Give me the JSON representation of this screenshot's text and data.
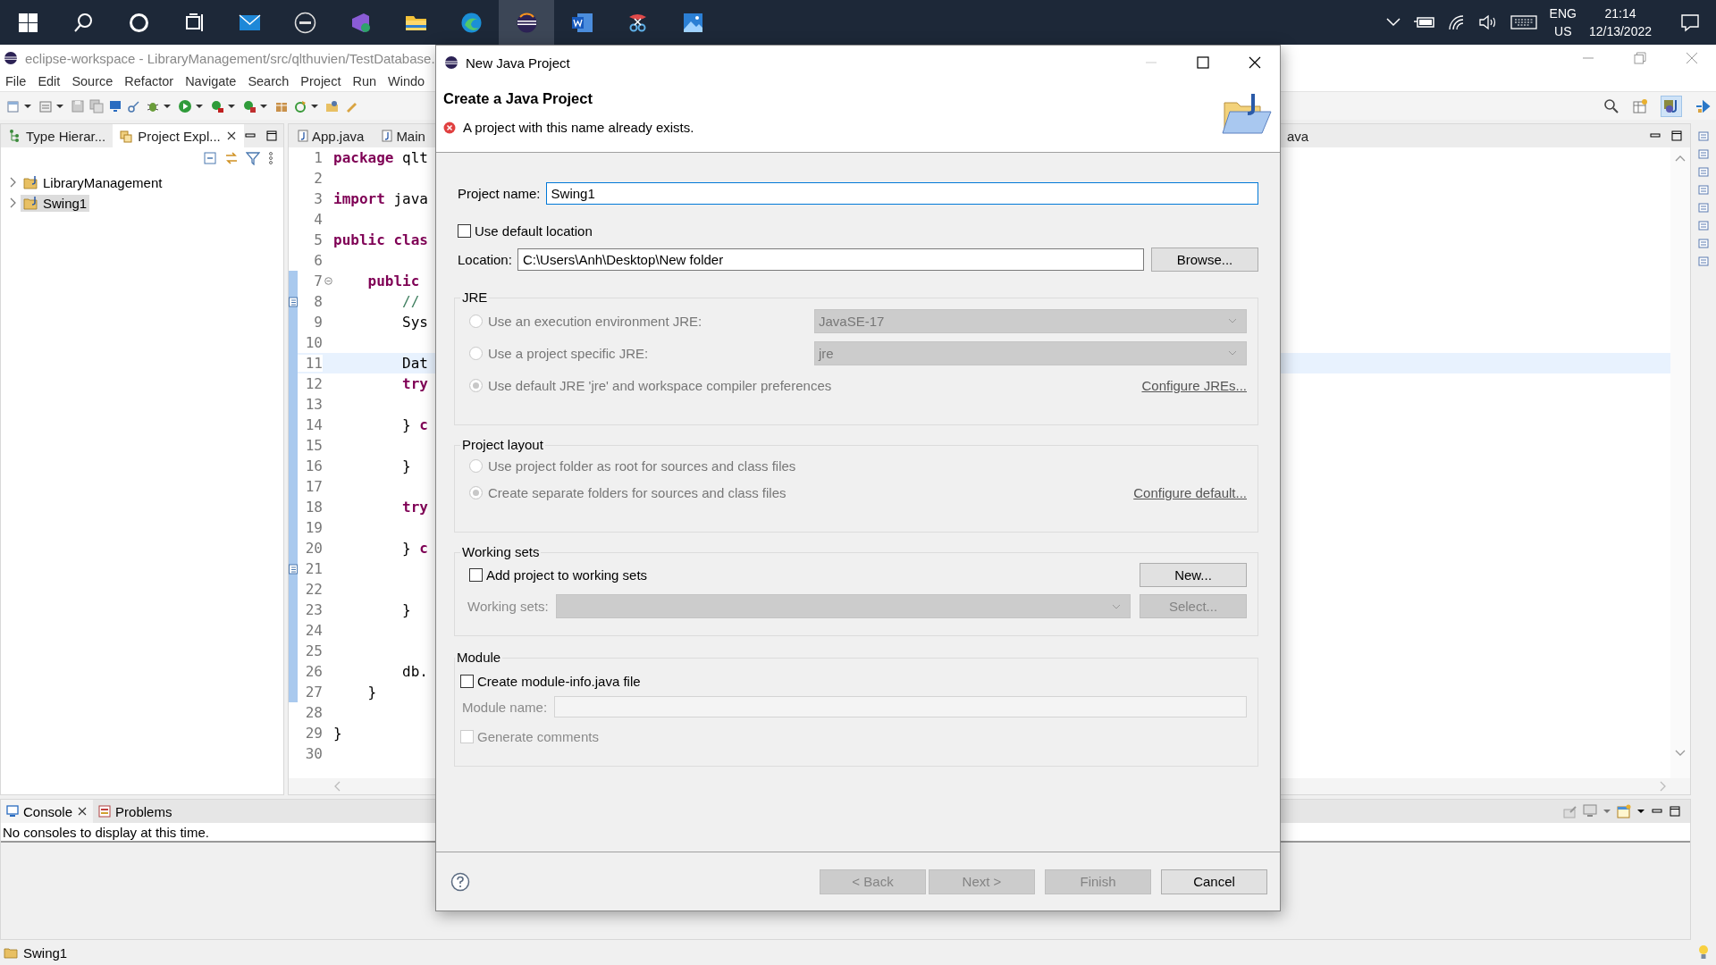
{
  "taskbar": {
    "apps": [
      {
        "kind": "start",
        "active": false
      },
      {
        "kind": "search",
        "active": false
      },
      {
        "kind": "cortana",
        "active": false
      },
      {
        "kind": "taskview",
        "active": false
      },
      {
        "kind": "mail",
        "active": false
      },
      {
        "kind": "dell",
        "active": false
      },
      {
        "kind": "vs",
        "active": false
      },
      {
        "kind": "folder",
        "active": false
      },
      {
        "kind": "edge",
        "active": false
      },
      {
        "kind": "eclipse",
        "active": true
      },
      {
        "kind": "word",
        "active": false
      },
      {
        "kind": "snip",
        "active": false
      },
      {
        "kind": "photos",
        "active": false
      }
    ],
    "language": "ENG",
    "region": "US",
    "time": "21:14",
    "date": "12/13/2022"
  },
  "window": {
    "title": "eclipse-workspace - LibraryManagement/src/qlthuvien/TestDatabase."
  },
  "menu": [
    "File",
    "Edit",
    "Source",
    "Refactor",
    "Navigate",
    "Search",
    "Project",
    "Run",
    "Windo"
  ],
  "left_view": {
    "tabs": [
      {
        "label": "Type Hierar...",
        "selected": false,
        "closable": false
      },
      {
        "label": "Project Expl...",
        "selected": true,
        "closable": true
      }
    ],
    "tree": [
      {
        "label": "LibraryManagement",
        "selected": false,
        "expanded": false
      },
      {
        "label": "Swing1",
        "selected": true,
        "expanded": false
      }
    ]
  },
  "editor": {
    "tabs": [
      "App.java",
      "Main",
      "ava"
    ],
    "lines": [
      {
        "number": "1",
        "kind": "code",
        "code": "**package** qlt",
        "current": false,
        "marked": false,
        "note": false,
        "fold": false
      },
      {
        "number": "2",
        "kind": "code",
        "current": false,
        "marked": false,
        "note": false,
        "fold": false
      },
      {
        "number": "3",
        "kind": "code",
        "code": "**import** java",
        "current": false,
        "marked": false,
        "note": false,
        "fold": false
      },
      {
        "number": "4",
        "kind": "code",
        "current": false,
        "marked": false,
        "note": false,
        "fold": false
      },
      {
        "number": "5",
        "kind": "code",
        "code": "**public** **clas**",
        "current": false,
        "marked": false,
        "note": false,
        "fold": false
      },
      {
        "number": "6",
        "kind": "code",
        "current": false,
        "marked": false,
        "note": false,
        "fold": false
      },
      {
        "number": "7",
        "kind": "code",
        "code": "    **public**",
        "current": false,
        "marked": true,
        "note": false,
        "fold": true
      },
      {
        "number": "8",
        "kind": "comment",
        "code": "        //",
        "current": false,
        "marked": true,
        "note": true,
        "fold": false
      },
      {
        "number": "9",
        "kind": "code",
        "code": "        Sys",
        "current": false,
        "marked": true,
        "note": false,
        "fold": false
      },
      {
        "number": "10",
        "kind": "code",
        "current": false,
        "marked": true,
        "note": false,
        "fold": false
      },
      {
        "number": "11",
        "kind": "code",
        "code": "        Dat",
        "current": true,
        "marked": true,
        "note": false,
        "fold": false
      },
      {
        "number": "12",
        "kind": "code",
        "code": "        **try**",
        "current": false,
        "marked": true,
        "note": false,
        "fold": false
      },
      {
        "number": "13",
        "kind": "code",
        "current": false,
        "marked": true,
        "note": false,
        "fold": false
      },
      {
        "number": "14",
        "kind": "code",
        "code": "        } **c**",
        "current": false,
        "marked": true,
        "note": false,
        "fold": false
      },
      {
        "number": "15",
        "kind": "code",
        "current": false,
        "marked": true,
        "note": false,
        "fold": false
      },
      {
        "number": "16",
        "kind": "code",
        "code": "        }",
        "current": false,
        "marked": true,
        "note": false,
        "fold": false
      },
      {
        "number": "17",
        "kind": "code",
        "current": false,
        "marked": true,
        "note": false,
        "fold": false
      },
      {
        "number": "18",
        "kind": "code",
        "code": "        **try**",
        "current": false,
        "marked": true,
        "note": false,
        "fold": false
      },
      {
        "number": "19",
        "kind": "code",
        "current": false,
        "marked": true,
        "note": false,
        "fold": false
      },
      {
        "number": "20",
        "kind": "code",
        "code": "        } **c**",
        "current": false,
        "marked": true,
        "note": false,
        "fold": false
      },
      {
        "number": "21",
        "kind": "code",
        "current": false,
        "marked": true,
        "note": true,
        "fold": false
      },
      {
        "number": "22",
        "kind": "code",
        "current": false,
        "marked": true,
        "note": false,
        "fold": false
      },
      {
        "number": "23",
        "kind": "code",
        "code": "        }",
        "current": false,
        "marked": true,
        "note": false,
        "fold": false
      },
      {
        "number": "24",
        "kind": "code",
        "current": false,
        "marked": true,
        "note": false,
        "fold": false
      },
      {
        "number": "25",
        "kind": "code",
        "current": false,
        "marked": true,
        "note": false,
        "fold": false
      },
      {
        "number": "26",
        "kind": "code",
        "code": "        db.",
        "current": false,
        "marked": true,
        "note": false,
        "fold": false
      },
      {
        "number": "27",
        "kind": "code",
        "code": "    }",
        "current": false,
        "marked": true,
        "note": false,
        "fold": false
      },
      {
        "number": "28",
        "kind": "code",
        "current": false,
        "marked": false,
        "note": false,
        "fold": false
      },
      {
        "number": "29",
        "kind": "code",
        "code": "}",
        "current": false,
        "marked": false,
        "note": false,
        "fold": false
      },
      {
        "number": "30",
        "kind": "code",
        "current": false,
        "marked": false,
        "note": false,
        "fold": false
      }
    ]
  },
  "console": {
    "tabs": [
      {
        "label": "Console",
        "selected": true,
        "closable": true
      },
      {
        "label": "Problems",
        "selected": false,
        "closable": false
      }
    ],
    "message": "No consoles to display at this time."
  },
  "status_bar": {
    "text": "Swing1"
  },
  "dialog": {
    "title": "New Java Project",
    "heading": "Create a Java Project",
    "error": "A project with this name already exists.",
    "project_name": {
      "label": "Project name:",
      "value": "Swing1"
    },
    "use_default_location": {
      "label": "Use default location",
      "checked": false
    },
    "location": {
      "label": "Location:",
      "value": "C:\\Users\\Anh\\Desktop\\New folder",
      "button": "Browse..."
    },
    "jre": {
      "title": "JRE",
      "options": [
        {
          "label": "Use an execution environment JRE:",
          "selected": false,
          "disabled": true,
          "dropdown": "JavaSE-17"
        },
        {
          "label": "Use a project specific JRE:",
          "selected": false,
          "disabled": true,
          "dropdown": "jre"
        },
        {
          "label": "Use default JRE 'jre' and workspace compiler preferences",
          "selected": true,
          "disabled": true,
          "link": "Configure JREs..."
        }
      ]
    },
    "project_layout": {
      "title": "Project layout",
      "options": [
        {
          "label": "Use project folder as root for sources and class files",
          "selected": false,
          "disabled": true
        },
        {
          "label": "Create separate folders for sources and class files",
          "selected": true,
          "disabled": true,
          "link": "Configure default..."
        }
      ]
    },
    "working_sets": {
      "title": "Working sets",
      "checkbox": {
        "label": "Add project to working sets",
        "checked": false
      },
      "new_button": "New...",
      "sets_label": "Working sets:",
      "select_button": "Select...",
      "disabled": true
    },
    "module": {
      "title": "Module",
      "checkbox": {
        "label": "Create module-info.java file",
        "checked": false
      },
      "name_label": "Module name:",
      "disabled": true,
      "comments": {
        "label": "Generate comments",
        "checked": false,
        "disabled": true
      }
    },
    "buttons": [
      {
        "label": "< Back",
        "disabled": true
      },
      {
        "label": "Next >",
        "disabled": true
      },
      {
        "label": "Finish",
        "disabled": true
      },
      {
        "label": "Cancel",
        "disabled": false
      }
    ]
  }
}
